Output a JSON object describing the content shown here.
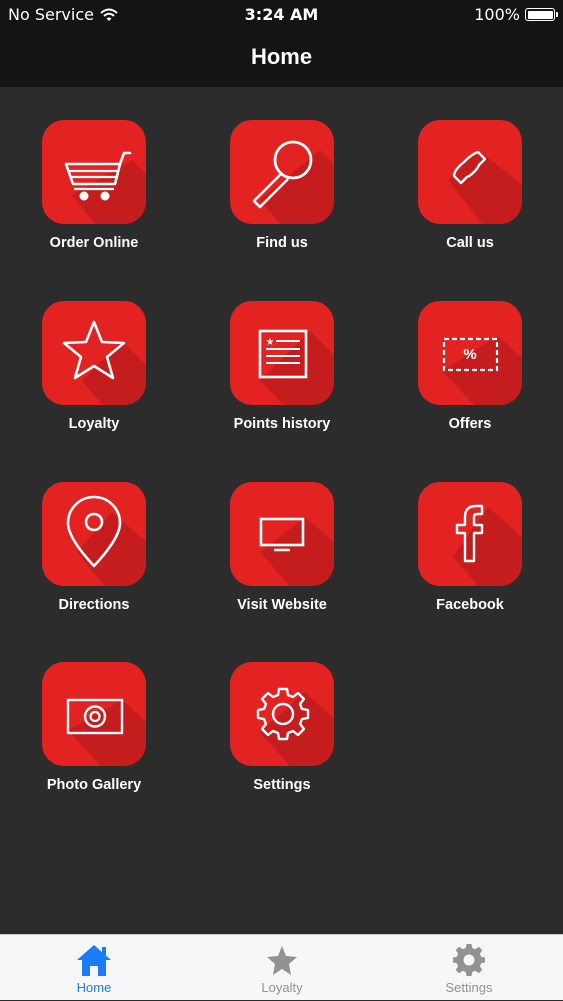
{
  "status_bar": {
    "carrier": "No Service",
    "time": "3:24 AM",
    "battery": "100%"
  },
  "nav": {
    "title": "Home"
  },
  "tiles": [
    {
      "label": "Order Online",
      "icon": "cart-icon"
    },
    {
      "label": "Find us",
      "icon": "magnifier-icon"
    },
    {
      "label": "Call us",
      "icon": "phone-icon"
    },
    {
      "label": "Loyalty",
      "icon": "star-icon"
    },
    {
      "label": "Points history",
      "icon": "document-icon"
    },
    {
      "label": "Offers",
      "icon": "coupon-icon",
      "glyph_text": "%"
    },
    {
      "label": "Directions",
      "icon": "map-pin-icon"
    },
    {
      "label": "Visit Website",
      "icon": "monitor-icon"
    },
    {
      "label": "Facebook",
      "icon": "facebook-icon"
    },
    {
      "label": "Photo Gallery",
      "icon": "camera-icon"
    },
    {
      "label": "Settings",
      "icon": "gear-icon"
    }
  ],
  "tab_bar": {
    "tabs": [
      {
        "label": "Home",
        "icon": "home-icon",
        "active": true
      },
      {
        "label": "Loyalty",
        "icon": "star-icon",
        "active": false
      },
      {
        "label": "Settings",
        "icon": "gear-icon",
        "active": false
      }
    ]
  },
  "colors": {
    "background": "#2d2c2d",
    "bar": "#141414",
    "tile": "#e32222",
    "active_tab": "#1a7cf7",
    "inactive_tab": "#929292"
  }
}
